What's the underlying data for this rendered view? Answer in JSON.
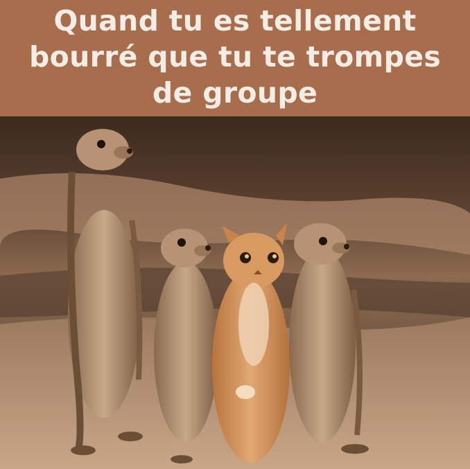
{
  "caption": {
    "line_1": "Quand tu es tellement",
    "line_2": "bourré que tu te trompes",
    "line_3": "de groupe"
  },
  "colors": {
    "caption_band": "#a86d4d",
    "caption_text": "#f4ede6"
  },
  "photo": {
    "subjects": [
      "meerkat",
      "meerkat",
      "cat",
      "meerkat"
    ]
  }
}
